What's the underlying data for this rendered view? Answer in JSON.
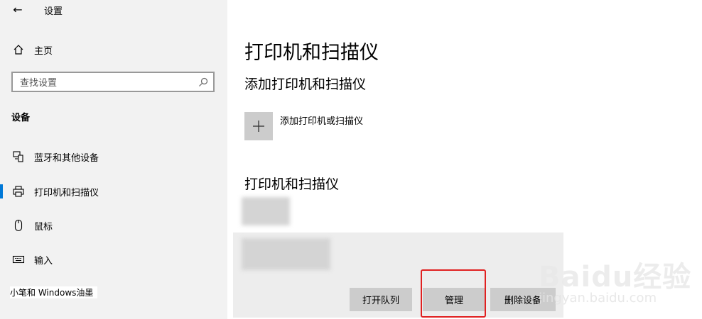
{
  "window": {
    "title": "设置"
  },
  "sidebar": {
    "home_label": "主页",
    "search_placeholder": "查找设置",
    "section_header": "设备",
    "items": [
      {
        "label": "蓝牙和其他设备",
        "icon": "bluetooth-devices-icon"
      },
      {
        "label": "打印机和扫描仪",
        "icon": "printer-icon",
        "active": true
      },
      {
        "label": "鼠标",
        "icon": "mouse-icon"
      },
      {
        "label": "输入",
        "icon": "keyboard-icon"
      }
    ],
    "bottom_note": "小笔和 Windows油墨"
  },
  "main": {
    "page_title": "打印机和扫描仪",
    "add_section_title": "添加打印机和扫描仪",
    "add_device_label": "添加打印机或扫描仪",
    "list_title": "打印机和扫描仪",
    "buttons": {
      "open_queue": "打开队列",
      "manage": "管理",
      "remove_device": "删除设备"
    }
  },
  "watermark": {
    "logo": "Baidu经验",
    "url": "jingyan.baidu.com"
  },
  "colors": {
    "accent": "#0078d7",
    "highlight": "#e02020",
    "sidebar_bg": "#f2f2f2",
    "button_bg": "#cccccc"
  }
}
